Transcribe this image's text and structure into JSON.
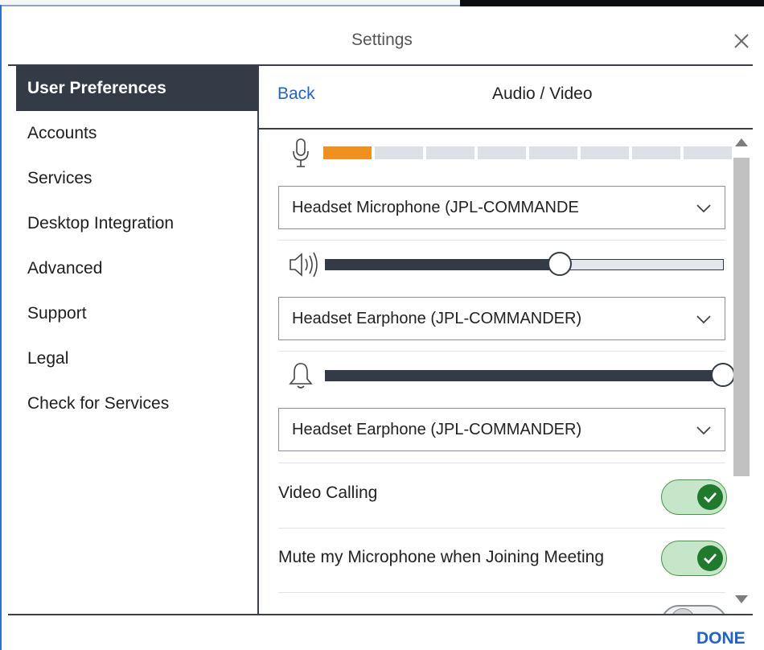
{
  "window": {
    "title": "Settings"
  },
  "sidebar": {
    "items": [
      {
        "label": "User Preferences",
        "active": true
      },
      {
        "label": "Accounts"
      },
      {
        "label": "Services"
      },
      {
        "label": "Desktop Integration"
      },
      {
        "label": "Advanced"
      },
      {
        "label": "Support"
      },
      {
        "label": "Legal"
      },
      {
        "label": "Check for Services"
      }
    ]
  },
  "panel": {
    "back_label": "Back",
    "title": "Audio / Video",
    "mic_level": {
      "segments_total": 8,
      "segments_active": 1,
      "active_color": "#f0901e"
    },
    "microphone_select": {
      "value": "Headset Microphone (JPL-COMMANDE"
    },
    "speaker_volume": {
      "level_percent": 59
    },
    "speaker_select": {
      "value": "Headset Earphone (JPL-COMMANDER)"
    },
    "ringer_volume": {
      "level_percent": 100
    },
    "ringer_select": {
      "value": "Headset Earphone (JPL-COMMANDER)"
    },
    "toggles": [
      {
        "label": "Video Calling",
        "on": true
      },
      {
        "label": "Mute my Microphone when Joining Meeting",
        "on": true
      }
    ]
  },
  "footer": {
    "done_label": "DONE"
  },
  "colors": {
    "accent": "#1d63d6",
    "toggle_on": "#1f7a2c",
    "sidebar_active_bg": "#343b46"
  },
  "icons": [
    "close-icon",
    "microphone-icon",
    "speaker-icon",
    "bell-icon",
    "chevron-down-icon",
    "check-icon"
  ]
}
